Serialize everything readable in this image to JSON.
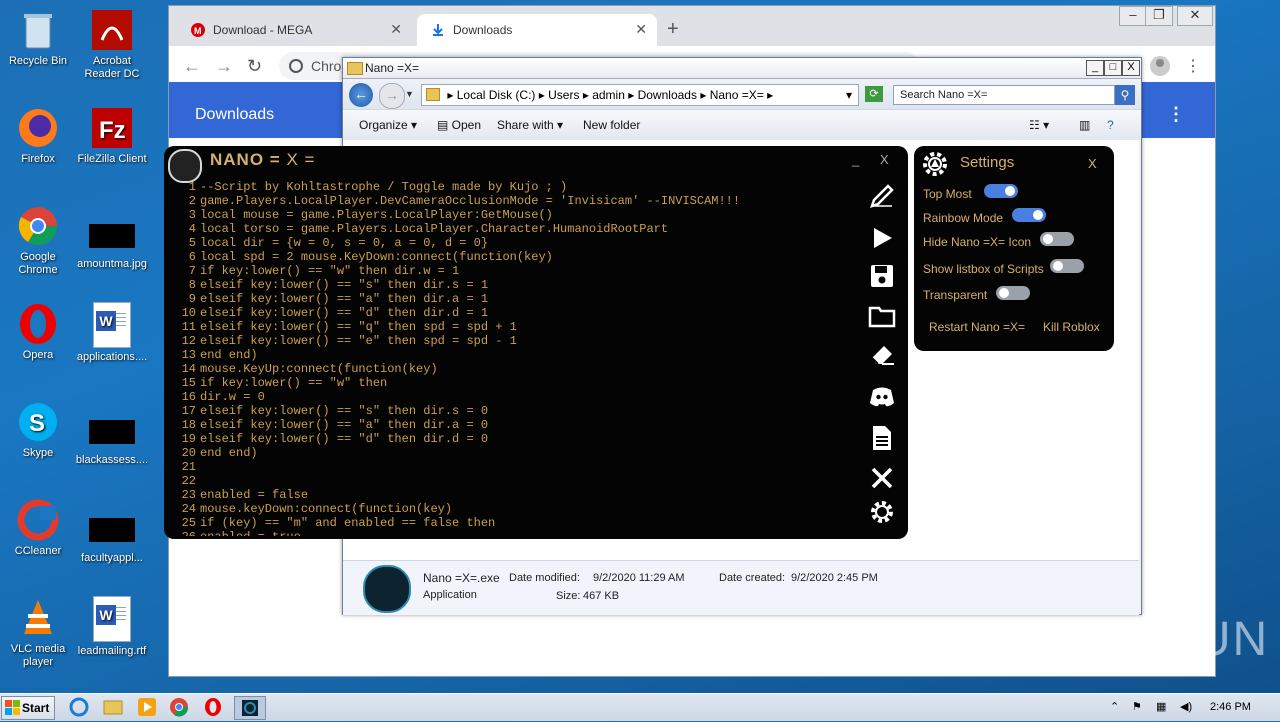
{
  "desktop": {
    "icons": [
      {
        "label": "Recycle Bin"
      },
      {
        "label": "Acrobat Reader DC"
      },
      {
        "label": "Firefox"
      },
      {
        "label": "FileZilla Client"
      },
      {
        "label": "Google Chrome"
      },
      {
        "label": "amountma.jpg"
      },
      {
        "label": "Opera"
      },
      {
        "label": "applications...."
      },
      {
        "label": "Skype"
      },
      {
        "label": "blackassess...."
      },
      {
        "label": "CCleaner"
      },
      {
        "label": "facultyappl..."
      },
      {
        "label": "VLC media player"
      },
      {
        "label": "leadmailing.rtf"
      }
    ]
  },
  "chrome": {
    "tabs": [
      {
        "title": "Download - MEGA"
      },
      {
        "title": "Downloads"
      }
    ],
    "omnibox_text": "Chro",
    "page_header": "Downloads"
  },
  "explorer": {
    "title": "Nano =X=",
    "breadcrumb": [
      "Local Disk (C:)",
      "Users",
      "admin",
      "Downloads",
      "Nano =X="
    ],
    "search_placeholder": "Search Nano =X=",
    "toolbar": {
      "organize": "Organize",
      "open": "Open",
      "share_with": "Share with",
      "new_folder": "New folder"
    },
    "status": {
      "file_name": "Nano =X=.exe",
      "file_type": "Application",
      "date_modified_label": "Date modified:",
      "date_modified": "9/2/2020 11:29 AM",
      "date_created_label": "Date created:",
      "date_created": "9/2/2020 2:45 PM",
      "size_label": "Size:",
      "size": "467 KB"
    }
  },
  "nano": {
    "title": "NANO =",
    "title_x": "X =",
    "min": "_",
    "close": "X",
    "code_lines": [
      {
        "n": "1",
        "t": "--Script by Kohltastrophe / Toggle made by Kujo ; )"
      },
      {
        "n": "2",
        "t": "game.Players.LocalPlayer.DevCameraOcclusionMode = 'Invisicam' --INVISCAM!!!"
      },
      {
        "n": "3",
        "t": "local mouse = game.Players.LocalPlayer:GetMouse()"
      },
      {
        "n": "4",
        "t": "local torso = game.Players.LocalPlayer.Character.HumanoidRootPart"
      },
      {
        "n": "5",
        "t": "local dir = {w = 0, s = 0, a = 0, d = 0}"
      },
      {
        "n": "6",
        "t": "local spd = 2 mouse.KeyDown:connect(function(key)"
      },
      {
        "n": "7",
        "t": "if key:lower() == \"w\" then dir.w = 1"
      },
      {
        "n": "8",
        "t": "elseif key:lower() == \"s\" then dir.s = 1"
      },
      {
        "n": "9",
        "t": "elseif key:lower() == \"a\" then dir.a = 1"
      },
      {
        "n": "10",
        "t": "elseif key:lower() == \"d\" then dir.d = 1"
      },
      {
        "n": "11",
        "t": "elseif key:lower() == \"q\" then spd = spd + 1"
      },
      {
        "n": "12",
        "t": "elseif key:lower() == \"e\" then spd = spd - 1"
      },
      {
        "n": "13",
        "t": "end end)"
      },
      {
        "n": "14",
        "t": "mouse.KeyUp:connect(function(key)"
      },
      {
        "n": "15",
        "t": "if key:lower() == \"w\" then"
      },
      {
        "n": "16",
        "t": "dir.w = 0"
      },
      {
        "n": "17",
        "t": "elseif key:lower() == \"s\" then dir.s = 0"
      },
      {
        "n": "18",
        "t": "elseif key:lower() == \"a\" then dir.a = 0"
      },
      {
        "n": "19",
        "t": "elseif key:lower() == \"d\" then dir.d = 0"
      },
      {
        "n": "20",
        "t": "end end)"
      },
      {
        "n": "21",
        "t": ""
      },
      {
        "n": "22",
        "t": ""
      },
      {
        "n": "23",
        "t": "enabled = false"
      },
      {
        "n": "24",
        "t": "mouse.keyDown:connect(function(key)"
      },
      {
        "n": "25",
        "t": "if (key) == \"m\" and enabled == false then"
      },
      {
        "n": "26",
        "t": "enabled = true"
      }
    ],
    "sidebar_icons": [
      "edit-icon",
      "play-icon",
      "save-icon",
      "folder-icon",
      "eraser-icon",
      "discord-icon",
      "script-list-icon",
      "tools-icon",
      "settings-gear-icon"
    ]
  },
  "settings": {
    "title": "Settings",
    "close": "X",
    "options": [
      {
        "label": "Top Most",
        "on": true
      },
      {
        "label": "Rainbow Mode",
        "on": true
      },
      {
        "label": "Hide Nano =X= Icon",
        "on": false
      },
      {
        "label": "Show listbox of Scripts",
        "on": false
      },
      {
        "label": "Transparent",
        "on": false
      }
    ],
    "restart": "Restart Nano =X=",
    "kill": "Kill Roblox"
  },
  "taskbar": {
    "start": "Start",
    "time": "2:46 PM"
  },
  "watermark": "ANY RUN",
  "colors": {
    "nano_gold": "#c9a04e",
    "toggle_on": "#4a7fe2",
    "toggle_off": "#9aa1a8",
    "chrome_blue": "#3367d6"
  }
}
